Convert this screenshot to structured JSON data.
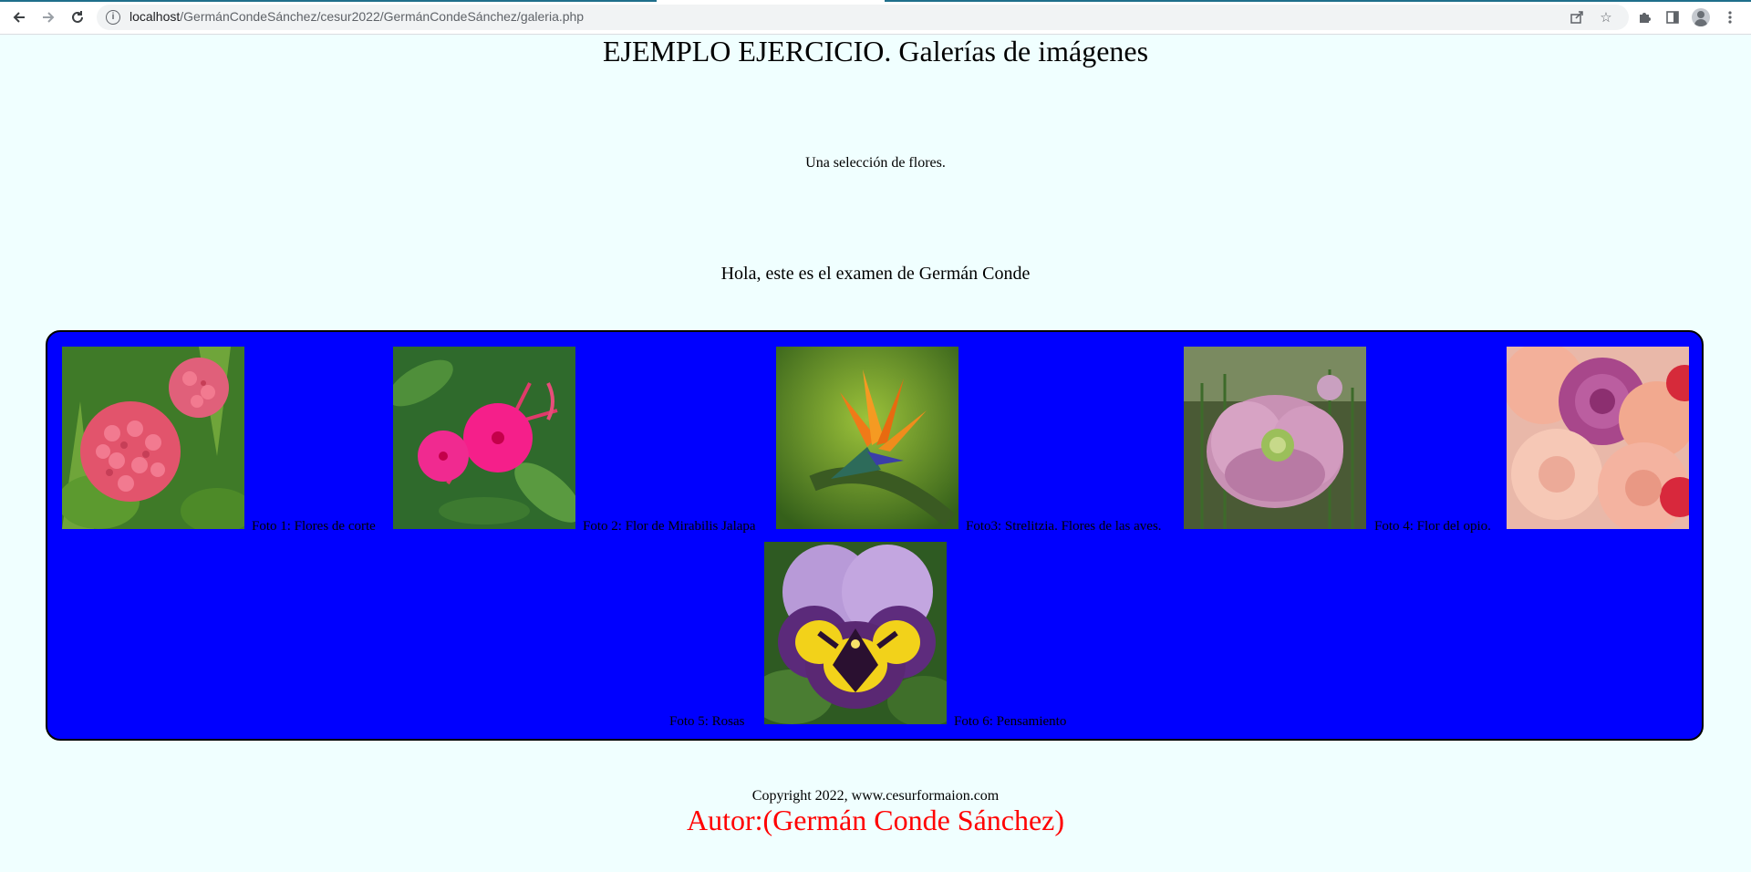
{
  "browser": {
    "url_host": "localhost",
    "url_path": "/GermánCondeSánchez/cesur2022/GermánCondeSánchez/galeria.php",
    "icons": [
      "back-arrow-icon",
      "forward-arrow-icon",
      "reload-icon",
      "site-info-icon",
      "share-icon",
      "bookmark-star-icon",
      "extensions-puzzle-icon",
      "side-panel-icon",
      "profile-avatar-icon",
      "menu-kebab-icon"
    ]
  },
  "page": {
    "title": "EJEMPLO EJERCICIO. Galerías de imágenes",
    "subtitle": "Una selección de flores.",
    "greeting": "Hola, este es el examen de Germán Conde"
  },
  "gallery": {
    "background": "#0000ff",
    "captions": [
      "Foto 1: Flores de corte",
      "Foto 2: Flor de Mirabilis Jalapa",
      "Foto3: Strelitzia. Flores de las aves.",
      "Foto 4: Flor del opio.",
      "Foto 5: Rosas",
      "Foto 6: Pensamiento"
    ]
  },
  "footer": {
    "copyright": "Copyright 2022, www.cesurformaion.com",
    "author": "Autor:(Germán Conde Sánchez)",
    "author_color": "#ff0000"
  }
}
